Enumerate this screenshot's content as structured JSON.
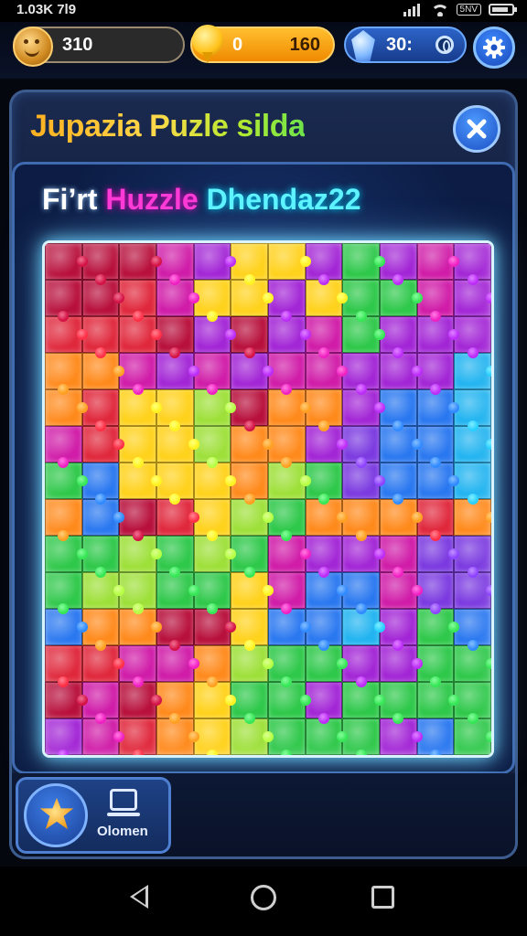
{
  "status_bar": {
    "time": "1.03K 7l9",
    "network": "5NV"
  },
  "currency": {
    "coins": "310",
    "gold_left": "0",
    "gold_right": "160",
    "gems": "30:"
  },
  "panel": {
    "title": "Jupazia Puzle silda",
    "subtitle_a": "Fi’rt ",
    "subtitle_b": "Huzzle ",
    "subtitle_c": "Dhendaz22"
  },
  "bottom": {
    "quit_label": "Olomen"
  },
  "board": {
    "columns": 12,
    "rows": 14,
    "colors": {
      "red": "#e0283c",
      "crimson": "#b8103c",
      "magenta": "#d01ca8",
      "purple": "#a326d6",
      "violet": "#7b3ae0",
      "orange": "#ff8a1c",
      "yellow": "#ffd21c",
      "lime": "#9ee03a",
      "green": "#2ec84a",
      "teal": "#1cc8a8",
      "blue": "#2a78f0",
      "cyan": "#22b4f0"
    },
    "grid": [
      [
        "crimson",
        "crimson",
        "crimson",
        "magenta",
        "purple",
        "yellow",
        "yellow",
        "purple",
        "green",
        "purple",
        "magenta",
        "purple"
      ],
      [
        "crimson",
        "crimson",
        "red",
        "magenta",
        "yellow",
        "yellow",
        "purple",
        "yellow",
        "green",
        "green",
        "magenta",
        "purple"
      ],
      [
        "red",
        "red",
        "red",
        "crimson",
        "purple",
        "crimson",
        "purple",
        "magenta",
        "green",
        "purple",
        "purple",
        "purple"
      ],
      [
        "orange",
        "orange",
        "magenta",
        "purple",
        "magenta",
        "purple",
        "magenta",
        "magenta",
        "purple",
        "purple",
        "purple",
        "cyan"
      ],
      [
        "orange",
        "red",
        "yellow",
        "yellow",
        "lime",
        "crimson",
        "orange",
        "orange",
        "purple",
        "blue",
        "blue",
        "cyan"
      ],
      [
        "magenta",
        "red",
        "yellow",
        "yellow",
        "lime",
        "orange",
        "orange",
        "purple",
        "violet",
        "blue",
        "blue",
        "cyan"
      ],
      [
        "green",
        "blue",
        "yellow",
        "yellow",
        "yellow",
        "orange",
        "lime",
        "green",
        "violet",
        "blue",
        "blue",
        "cyan"
      ],
      [
        "orange",
        "blue",
        "crimson",
        "red",
        "yellow",
        "lime",
        "green",
        "orange",
        "orange",
        "orange",
        "red",
        "orange"
      ],
      [
        "green",
        "green",
        "lime",
        "green",
        "lime",
        "green",
        "magenta",
        "purple",
        "purple",
        "magenta",
        "violet",
        "violet"
      ],
      [
        "green",
        "lime",
        "lime",
        "green",
        "green",
        "yellow",
        "magenta",
        "blue",
        "blue",
        "magenta",
        "violet",
        "violet"
      ],
      [
        "blue",
        "orange",
        "orange",
        "crimson",
        "crimson",
        "yellow",
        "blue",
        "blue",
        "cyan",
        "purple",
        "green",
        "blue"
      ],
      [
        "red",
        "red",
        "magenta",
        "magenta",
        "orange",
        "lime",
        "green",
        "green",
        "purple",
        "purple",
        "green",
        "green"
      ],
      [
        "crimson",
        "magenta",
        "crimson",
        "orange",
        "yellow",
        "green",
        "green",
        "purple",
        "green",
        "green",
        "green",
        "green"
      ],
      [
        "purple",
        "magenta",
        "red",
        "orange",
        "yellow",
        "lime",
        "green",
        "green",
        "green",
        "purple",
        "blue",
        "green"
      ]
    ]
  }
}
